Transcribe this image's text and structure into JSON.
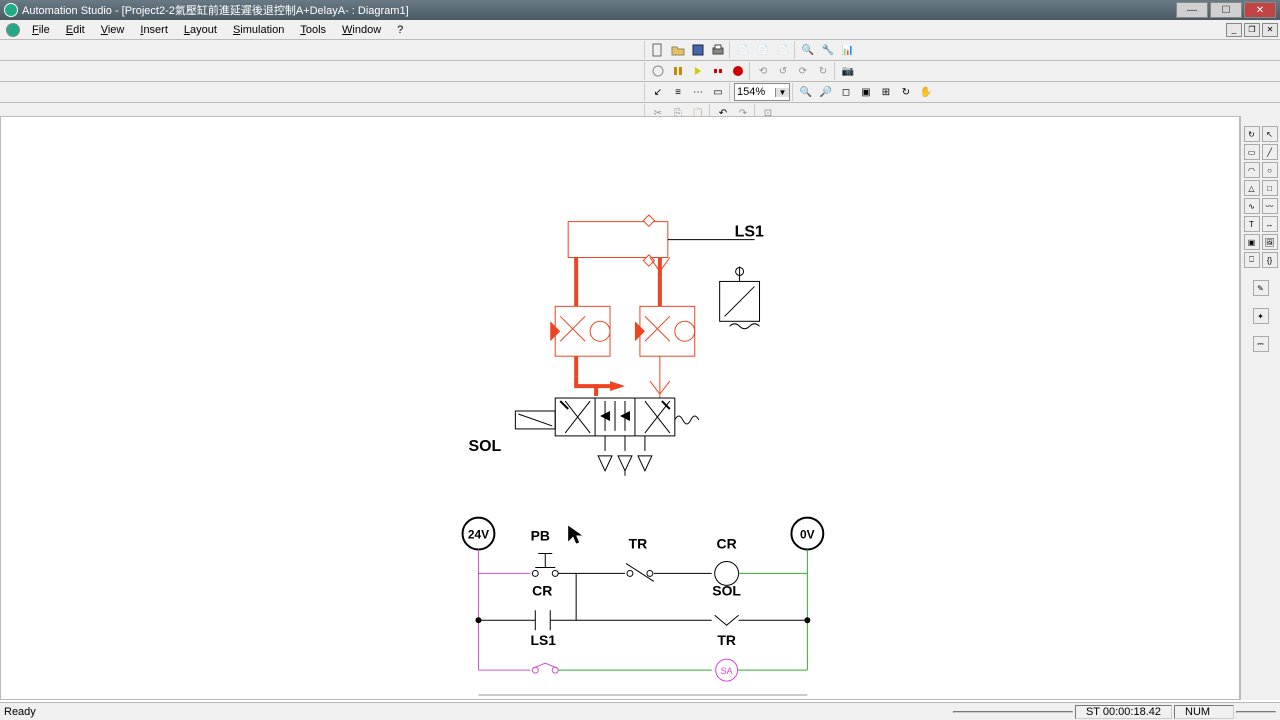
{
  "window": {
    "title": "Automation Studio - [Project2-2氣壓缸前進延遲後退控制A+DelayA- : Diagram1]"
  },
  "menus": {
    "file": "File",
    "edit": "Edit",
    "view": "View",
    "insert": "Insert",
    "layout": "Layout",
    "simulation": "Simulation",
    "tools": "Tools",
    "window": "Window",
    "help": "?"
  },
  "zoom": {
    "value": "154%"
  },
  "status": {
    "ready": "Ready",
    "time": "ST 00:00:18.42",
    "num": "NUM"
  },
  "diagram": {
    "sol_label": "SOL",
    "ls1_label": "LS1",
    "ladder": {
      "v24": "24V",
      "v0": "0V",
      "pb": "PB",
      "tr1": "TR",
      "cr_coil": "CR",
      "cr_contact": "CR",
      "sol_coil": "SOL",
      "ls1_contact": "LS1",
      "tr_coil": "TR",
      "sa": "SA"
    }
  }
}
